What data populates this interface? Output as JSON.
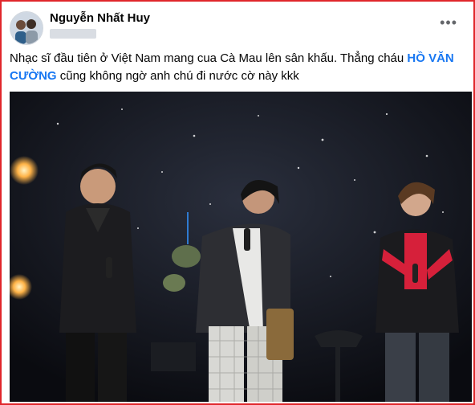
{
  "post": {
    "author_name": "Nguyễn Nhất Huy",
    "more_icon": "ellipsis-icon",
    "text_before": "Nhạc sĩ đầu tiên ở Việt Nam mang cua Cà Mau lên sân khấu. Thẳng cháu ",
    "tagged_name": "HỒ VĂN CƯỜNG",
    "text_after": " cũng không ngờ anh chú đi nước cờ này kkk"
  },
  "colors": {
    "border": "#e0262b",
    "link": "#1877f2",
    "text": "#050505",
    "stage_bg": "#0f1116",
    "stage_light": "#ffb347"
  }
}
